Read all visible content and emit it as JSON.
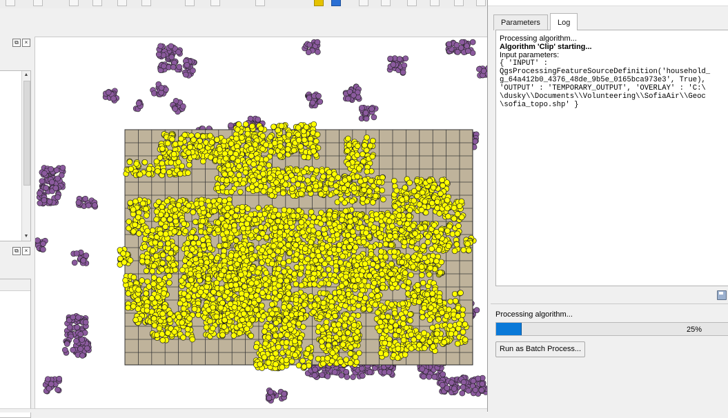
{
  "toolbar": {
    "visible": true
  },
  "left_panels": {
    "close_glyph": "×",
    "float_glyph": "⧉",
    "up_arrow": "▲",
    "down_arrow": "▼"
  },
  "processing_dialog": {
    "tabs": [
      {
        "label": "Parameters"
      },
      {
        "label": "Log",
        "active": true
      }
    ],
    "log_lines": [
      "Processing algorithm...",
      "Algorithm 'Clip' starting...",
      "Input parameters:",
      "{ 'INPUT' :",
      "QgsProcessingFeatureSourceDefinition('household_",
      "g_64a412b0_4376_48de_9b5e_0165bca973e3', True),",
      "'OUTPUT' : 'TEMPORARY_OUTPUT', 'OVERLAY' : 'C:\\",
      "\\dusky\\\\Documents\\\\Volunteering\\\\SofiaAir\\\\Geoc",
      "\\sofia_topo.shp' }"
    ],
    "status_text": "Processing algorithm...",
    "progress": {
      "value": 25,
      "label": "25%"
    },
    "batch_button": "Run as Batch Process...",
    "save_icon": "save-icon"
  },
  "map": {
    "grid_color": "#bfb39b",
    "purple_point_color": "#8b5a9e",
    "yellow_point_color": "#ffff00",
    "outline_color": "#222222"
  }
}
